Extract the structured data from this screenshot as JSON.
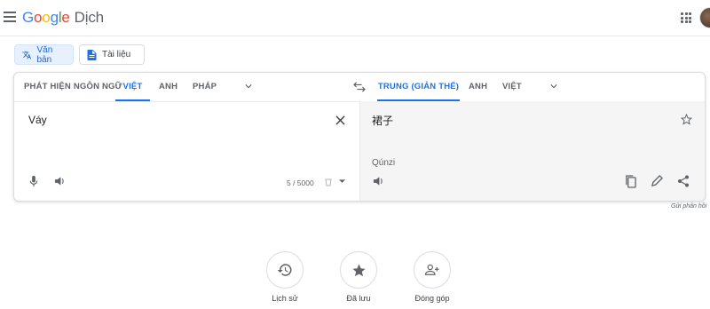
{
  "header": {
    "logo_parts": [
      "G",
      "o",
      "o",
      "g",
      "l",
      "e"
    ],
    "product": "Dịch"
  },
  "modes": {
    "text_label": "Văn bản",
    "docs_label": "Tài liệu"
  },
  "source_langs": [
    "PHÁT HIỆN NGÔN NGỮ",
    "VIỆT",
    "ANH",
    "PHÁP"
  ],
  "target_langs": [
    "TRUNG (GIẢN THỂ)",
    "ANH",
    "VIỆT"
  ],
  "source": {
    "text": "Váy",
    "count": "5 / 5000"
  },
  "target": {
    "text": "裙子",
    "romanization": "Qúnzi"
  },
  "feedback": "Gửi phản hồi",
  "bottom": {
    "history": "Lịch sử",
    "saved": "Đã lưu",
    "contribute": "Đóng góp"
  },
  "colors": {
    "accent": "#1a73e8",
    "active_bg": "#e8f0fe"
  }
}
